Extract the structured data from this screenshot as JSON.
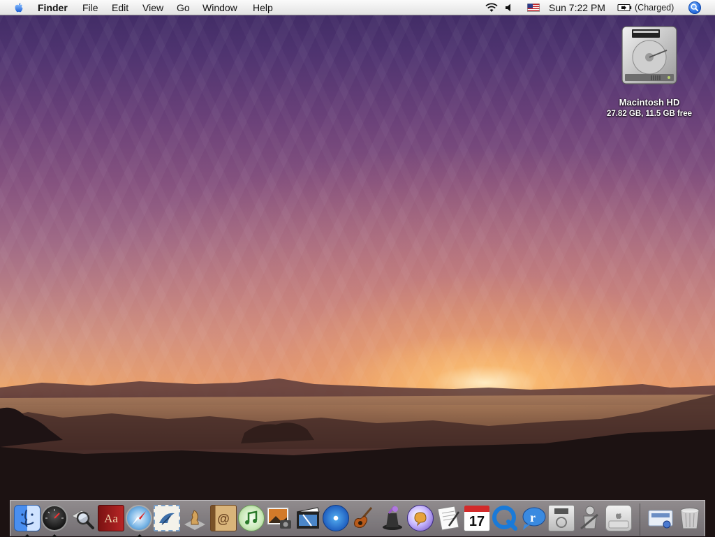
{
  "menubar": {
    "apple_icon": "apple-icon",
    "items": [
      {
        "label": "Finder",
        "bold": true
      },
      {
        "label": "File"
      },
      {
        "label": "Edit"
      },
      {
        "label": "View"
      },
      {
        "label": "Go"
      },
      {
        "label": "Window"
      },
      {
        "label": "Help"
      }
    ],
    "status": {
      "wifi_icon": "wifi-icon",
      "volume_icon": "speaker-icon",
      "input_icon": "us-flag-icon",
      "clock": "Sun 7:22 PM",
      "battery_icon": "battery-icon",
      "battery_text": "(Charged)",
      "spotlight_icon": "spotlight-icon"
    }
  },
  "desktop": {
    "disk": {
      "name": "Macintosh HD",
      "info": "27.82 GB, 11.5 GB free"
    }
  },
  "dock": {
    "apps": [
      {
        "name": "finder-icon",
        "running": true
      },
      {
        "name": "dashboard-icon",
        "running": true
      },
      {
        "name": "spotlight-magnifier-icon"
      },
      {
        "name": "dictionary-icon",
        "glyph": "Aa"
      },
      {
        "name": "safari-icon",
        "running": true
      },
      {
        "name": "mail-icon"
      },
      {
        "name": "chess-icon"
      },
      {
        "name": "address-book-icon",
        "glyph": "@"
      },
      {
        "name": "itunes-icon"
      },
      {
        "name": "iphoto-icon"
      },
      {
        "name": "imovie-icon"
      },
      {
        "name": "idvd-icon"
      },
      {
        "name": "garageband-icon"
      },
      {
        "name": "iweb-icon"
      },
      {
        "name": "ichat-icon"
      },
      {
        "name": "textedit-icon"
      },
      {
        "name": "ical-icon",
        "glyph": "17"
      },
      {
        "name": "quicktime-icon"
      },
      {
        "name": "realplayer-icon"
      },
      {
        "name": "dvd-player-icon"
      },
      {
        "name": "automator-icon"
      },
      {
        "name": "system-preferences-icon"
      }
    ],
    "right": [
      {
        "name": "downloads-stack-icon"
      },
      {
        "name": "trash-icon"
      }
    ]
  }
}
